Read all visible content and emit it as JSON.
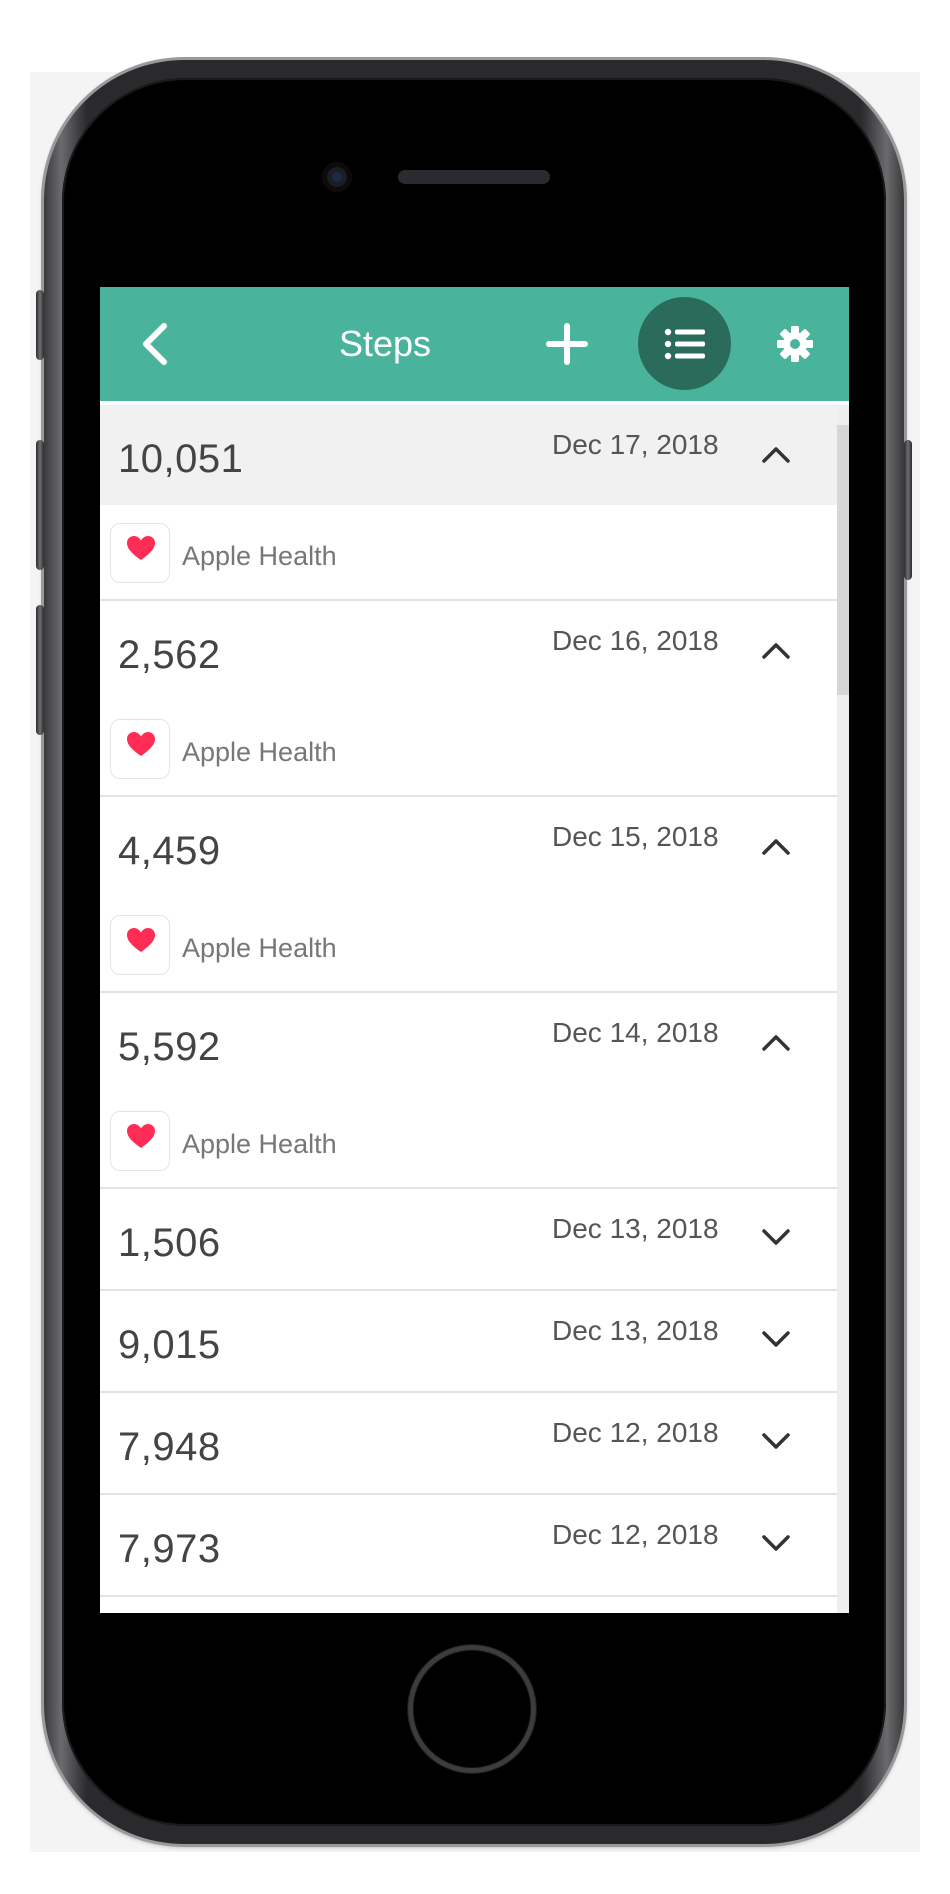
{
  "app_bar": {
    "title": "Steps",
    "accent_color": "#4ab39c",
    "active_button_color": "#2a6b5c",
    "icons": {
      "back": "chevron-left-icon",
      "add": "plus-icon",
      "list": "list-icon",
      "settings": "gear-icon"
    }
  },
  "entries": [
    {
      "value": "10,051",
      "date": "Dec 17, 2018",
      "expanded": true,
      "selected": true,
      "source": "Apple Health"
    },
    {
      "value": "2,562",
      "date": "Dec 16, 2018",
      "expanded": true,
      "selected": false,
      "source": "Apple Health"
    },
    {
      "value": "4,459",
      "date": "Dec 15, 2018",
      "expanded": true,
      "selected": false,
      "source": "Apple Health"
    },
    {
      "value": "5,592",
      "date": "Dec 14, 2018",
      "expanded": true,
      "selected": false,
      "source": "Apple Health"
    },
    {
      "value": "1,506",
      "date": "Dec 13, 2018",
      "expanded": false,
      "selected": false
    },
    {
      "value": "9,015",
      "date": "Dec 13, 2018",
      "expanded": false,
      "selected": false
    },
    {
      "value": "7,948",
      "date": "Dec 12, 2018",
      "expanded": false,
      "selected": false
    },
    {
      "value": "7,973",
      "date": "Dec 12, 2018",
      "expanded": false,
      "selected": false
    }
  ],
  "source_icon": "heart-icon",
  "heart_color": "#ff2d55"
}
